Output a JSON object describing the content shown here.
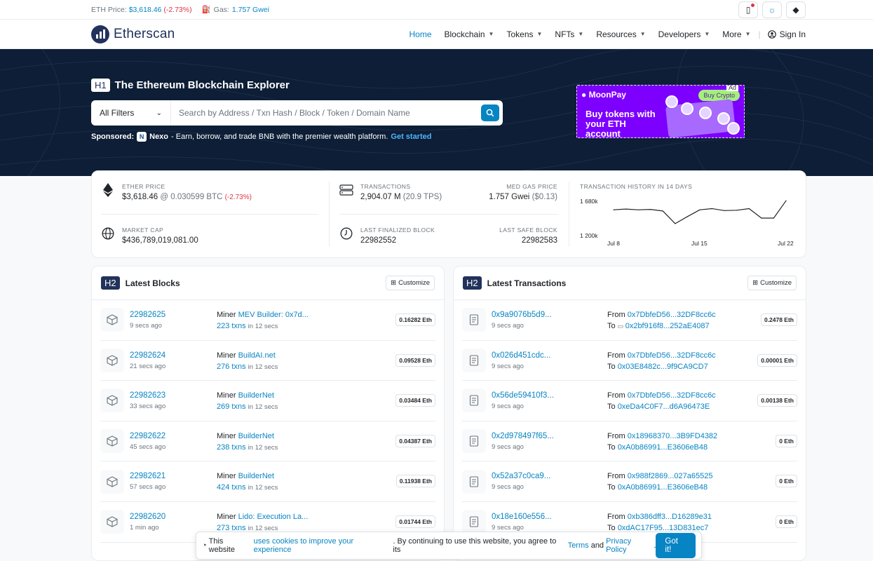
{
  "topbar": {
    "eth_price_label": "ETH Price:",
    "eth_price_value": "$3,618.46",
    "eth_price_change": "(-2.73%)",
    "gas_label": "Gas:",
    "gas_value": "1.757 Gwei"
  },
  "nav": {
    "brand": "Etherscan",
    "items": [
      "Home",
      "Blockchain",
      "Tokens",
      "NFTs",
      "Resources",
      "Developers",
      "More"
    ],
    "sign_in": "Sign In"
  },
  "hero": {
    "h1_tag": "H1",
    "title": "The Ethereum Blockchain Explorer",
    "filter": "All Filters",
    "search_placeholder": "Search by Address / Txn Hash / Block / Token / Domain Name",
    "sponsored_label": "Sponsored:",
    "sponsor_name": "Nexo",
    "sponsor_text": " - Earn, borrow, and trade BNB with the premier wealth platform.",
    "sponsor_cta": "Get started",
    "ad": {
      "tag": "Ad",
      "brand": "MoonPay",
      "cta": "Buy Crypto",
      "headline": "Buy tokens with your ETH account"
    }
  },
  "stats": {
    "ether_price_label": "ETHER PRICE",
    "ether_price": "$3,618.46",
    "ether_price_btc": "@ 0.030599 BTC",
    "ether_price_change": "(-2.73%)",
    "market_cap_label": "MARKET CAP",
    "market_cap": "$436,789,019,081.00",
    "transactions_label": "TRANSACTIONS",
    "transactions": "2,904.07 M",
    "tps": "(20.9 TPS)",
    "gas_label": "MED GAS PRICE",
    "gas": "1.757 Gwei",
    "gas_usd": "($0.13)",
    "finalized_label": "LAST FINALIZED BLOCK",
    "finalized": "22982552",
    "safe_label": "LAST SAFE BLOCK",
    "safe": "22982583",
    "history_label": "TRANSACTION HISTORY IN 14 DAYS",
    "y_top": "1 680k",
    "y_bottom": "1 200k",
    "x_ticks": [
      "Jul 8",
      "Jul 15",
      "Jul 22"
    ]
  },
  "chart_data": {
    "type": "line",
    "title": "TRANSACTION HISTORY IN 14 DAYS",
    "x": [
      "Jul 8",
      "Jul 9",
      "Jul 10",
      "Jul 11",
      "Jul 12",
      "Jul 13",
      "Jul 14",
      "Jul 15",
      "Jul 16",
      "Jul 17",
      "Jul 18",
      "Jul 19",
      "Jul 20",
      "Jul 21",
      "Jul 22"
    ],
    "values": [
      1545000,
      1555000,
      1545000,
      1550000,
      1530000,
      1370000,
      1460000,
      1545000,
      1560000,
      1535000,
      1540000,
      1560000,
      1440000,
      1440000,
      1660000
    ],
    "ylim": [
      1200000,
      1680000
    ],
    "yticks": [
      "1 680k",
      "1 200k"
    ]
  },
  "blocks": {
    "h2_tag": "H2",
    "title": "Latest Blocks",
    "customize": "Customize",
    "miner_label": "Miner",
    "in_label": "in 12 secs",
    "rows": [
      {
        "block": "22982625",
        "age": "9 secs ago",
        "miner": "MEV Builder: 0x7d...",
        "txns": "223 txns",
        "reward": "0.16282 Eth"
      },
      {
        "block": "22982624",
        "age": "21 secs ago",
        "miner": "BuildAI.net",
        "txns": "276 txns",
        "reward": "0.09528 Eth"
      },
      {
        "block": "22982623",
        "age": "33 secs ago",
        "miner": "BuilderNet",
        "txns": "269 txns",
        "reward": "0.03484 Eth"
      },
      {
        "block": "22982622",
        "age": "45 secs ago",
        "miner": "BuilderNet",
        "txns": "238 txns",
        "reward": "0.04387 Eth"
      },
      {
        "block": "22982621",
        "age": "57 secs ago",
        "miner": "BuilderNet",
        "txns": "424 txns",
        "reward": "0.11938 Eth"
      },
      {
        "block": "22982620",
        "age": "1 min ago",
        "miner": "Lido: Execution La...",
        "txns": "273 txns",
        "reward": "0.01744 Eth"
      }
    ]
  },
  "transactions": {
    "h2_tag": "H2",
    "title": "Latest Transactions",
    "customize": "Customize",
    "from_label": "From",
    "to_label": "To",
    "rows": [
      {
        "hash": "0x9a9076b5d9...",
        "age": "9 secs ago",
        "from": "0x7DbfeD56...32DF8cc6c",
        "to": "0x2bf916f8...252aE4087",
        "value": "0.2478 Eth"
      },
      {
        "hash": "0x026d451cdc...",
        "age": "9 secs ago",
        "from": "0x7DbfeD56...32DF8cc6c",
        "to": "0x03E8482c...9f9CA9CD7",
        "value": "0.00001 Eth"
      },
      {
        "hash": "0x56de59410f3...",
        "age": "9 secs ago",
        "from": "0x7DbfeD56...32DF8cc6c",
        "to": "0xeDa4C0F7...d6A96473E",
        "value": "0.00138 Eth"
      },
      {
        "hash": "0x2d978497f65...",
        "age": "9 secs ago",
        "from": "0x18968370...3B9FD4382",
        "to": "0xA0b86991...E3606eB48",
        "value": "0 Eth"
      },
      {
        "hash": "0x52a37c0ca9...",
        "age": "9 secs ago",
        "from": "0x988f2869...027a65525",
        "to": "0xA0b86991...E3606eB48",
        "value": "0 Eth"
      },
      {
        "hash": "0x18e160e556...",
        "age": "9 secs ago",
        "from": "0xb386dff3...D16289e31",
        "to": "0xdAC17F95...13D831ec7",
        "value": "0 Eth"
      }
    ]
  },
  "cookie": {
    "text1": "This website ",
    "link1": "uses cookies to improve your experience",
    "text2": ". By continuing to use this website, you agree to its ",
    "terms": "Terms",
    "and": " and ",
    "privacy": "Privacy Policy",
    "period": ".",
    "button": "Got it!"
  }
}
